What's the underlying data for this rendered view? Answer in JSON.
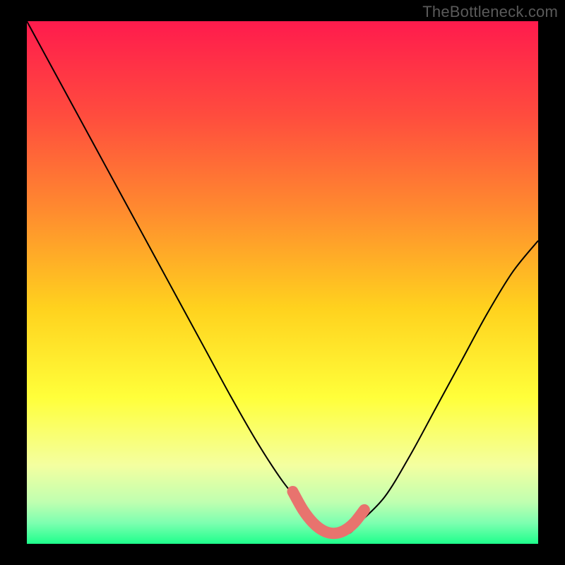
{
  "watermark": "TheBottleneck.com",
  "chart_data": {
    "type": "line",
    "title": "",
    "xlabel": "",
    "ylabel": "",
    "xlim": [
      0,
      100
    ],
    "ylim": [
      0,
      100
    ],
    "grid": false,
    "series": [
      {
        "name": "curve",
        "x": [
          0,
          5,
          10,
          15,
          20,
          25,
          30,
          35,
          40,
          45,
          50,
          55,
          57,
          60,
          63,
          65,
          70,
          75,
          80,
          85,
          90,
          95,
          100
        ],
        "values": [
          100,
          91,
          82,
          73,
          64,
          55,
          46,
          37,
          28,
          19.5,
          12,
          6,
          4,
          2,
          2,
          4,
          9,
          17,
          26,
          35,
          44,
          52,
          58
        ]
      }
    ],
    "highlight": {
      "name": "valley-highlight",
      "color": "#e8736e",
      "x": [
        52,
        54,
        56,
        58,
        60,
        62,
        64,
        66
      ],
      "values": [
        10,
        6.5,
        4,
        2.5,
        2,
        2.5,
        4,
        6.5
      ]
    },
    "background_gradient": {
      "stops": [
        {
          "offset": 0.0,
          "color": "#ff1b4d"
        },
        {
          "offset": 0.18,
          "color": "#ff4c3e"
        },
        {
          "offset": 0.36,
          "color": "#ff8a2f"
        },
        {
          "offset": 0.55,
          "color": "#ffd21e"
        },
        {
          "offset": 0.72,
          "color": "#ffff3a"
        },
        {
          "offset": 0.85,
          "color": "#f4ffa0"
        },
        {
          "offset": 0.92,
          "color": "#c0ffb0"
        },
        {
          "offset": 0.96,
          "color": "#7dffb0"
        },
        {
          "offset": 1.0,
          "color": "#1eff8c"
        }
      ]
    }
  }
}
